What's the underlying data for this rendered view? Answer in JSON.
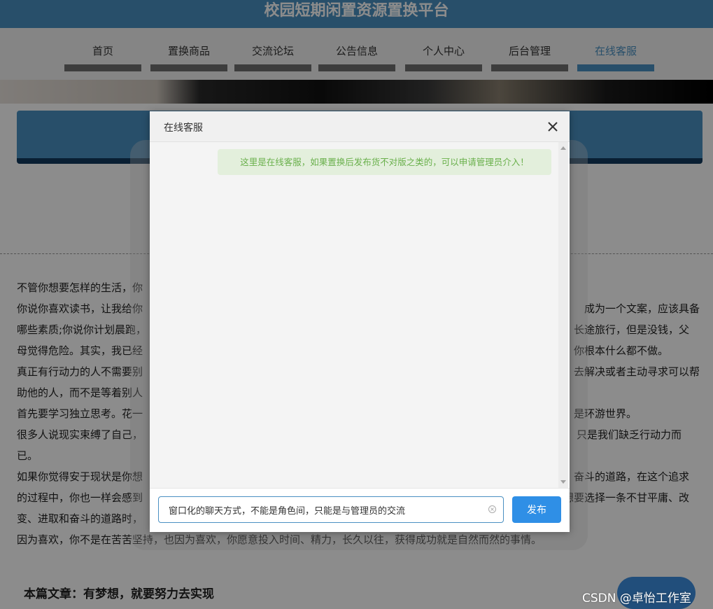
{
  "site": {
    "title": "校园短期闲置资源置换平台"
  },
  "nav": {
    "items": [
      {
        "label": "首页"
      },
      {
        "label": "置换商品"
      },
      {
        "label": "交流论坛"
      },
      {
        "label": "公告信息"
      },
      {
        "label": "个人中心"
      },
      {
        "label": "后台管理"
      },
      {
        "label": "在线客服"
      }
    ],
    "active": "在线客服"
  },
  "article": {
    "lines": [
      "不管你想要怎样的生活，你",
      "你说你喜欢读书，让我给你",
      "成为一个文案，应该具备",
      "哪些素质;你说你计划晨跑，",
      "长途旅行，但是没钱，父",
      "母觉得危险。其实，我已经",
      "你根本什么都不做。",
      "真正有行动力的人不需要别",
      "去解决或者主动寻求可以帮",
      "助他的人，而不是等着别人",
      "首先要学习独立思考。花一",
      "是环游世界。",
      "很多人说现实束缚了自己，",
      "只是我们缺乏行动力而",
      "已。",
      "如果你觉得安于现状是你想",
      "奋斗的道路，在这个追求",
      "的过程中，你也一样会感到",
      "想要选择一条不甘平庸、改",
      "变、进取和奋斗的道路时，",
      "因为喜欢，你不是在苦苦坚持，也因为喜欢，你愿意投入时间、精力，长久以往，获得成功就是自然而然的事情。"
    ],
    "footer": "本篇文章：有梦想，就要努力去实现"
  },
  "watermark": "CSDN @卓怡工作室",
  "dialog": {
    "title": "在线客服",
    "messages": [
      {
        "from": "admin",
        "text": "这里是在线客服，如果置换后发布货不对版之类的，可以申请管理员介入！"
      }
    ],
    "input_value": "窗口化的聊天方式，不能是角色间，只能是与管理员的交流",
    "send_label": "发布"
  },
  "colors": {
    "brand": "#4a90c2",
    "send_button": "#2f8fe6",
    "admin_bubble_bg": "#e3efdc",
    "admin_bubble_text": "#6ab04c"
  },
  "icons": {
    "close": "close-icon",
    "clear": "clear-input-icon"
  }
}
